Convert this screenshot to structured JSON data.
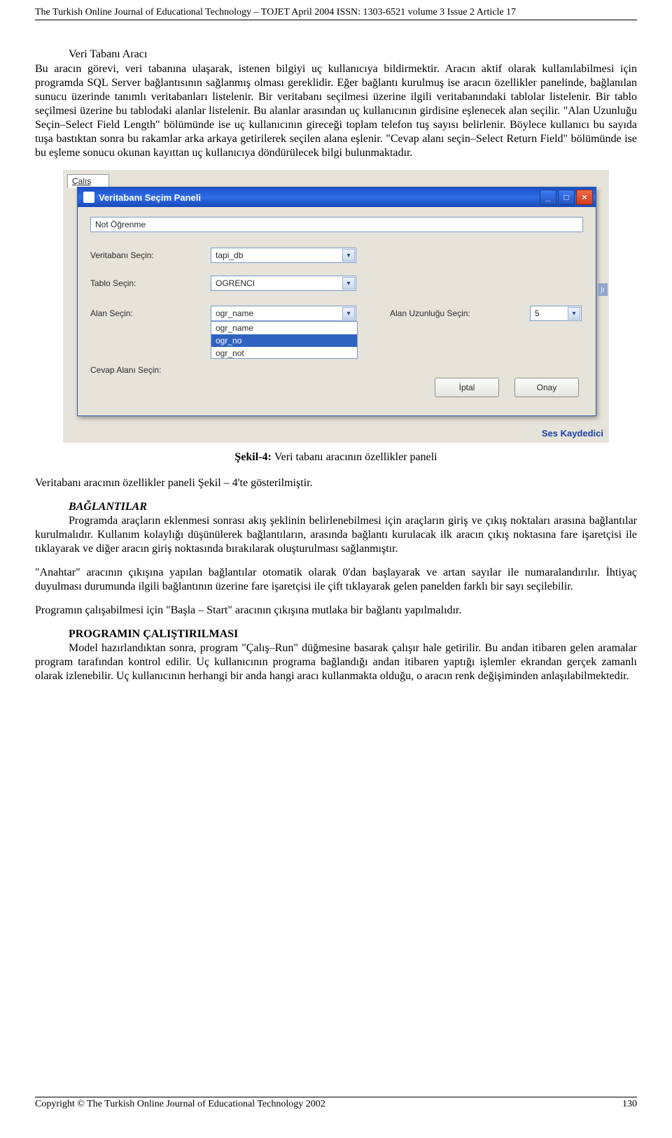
{
  "header_line": "The Turkish Online Journal of Educational Technology – TOJET April 2004 ISSN: 1303-6521 volume 3 Issue 2 Article 17",
  "section1_title": "Veri Tabanı Aracı",
  "section1_body": "Bu aracın görevi, veri tabanına ulaşarak, istenen bilgiyi uç kullanıcıya bildirmektir. Aracın aktif olarak kullanılabilmesi için programda SQL Server bağlantısının sağlanmış olması gereklidir. Eğer bağlantı kurulmuş ise aracın özellikler panelinde, bağlanılan sunucu üzerinde tanımlı veritabanları listelenir. Bir veritabanı seçilmesi üzerine ilgili veritabanındaki tablolar listelenir. Bir tablo seçilmesi üzerine bu tablodaki alanlar listelenir. Bu alanlar arasından uç kullanıcının girdisine eşlenecek alan seçilir. \"Alan Uzunluğu Seçin–Select Field Length\" bölümünde ise uç kullanıcının gireceği toplam telefon tuş sayısı belirlenir. Böylece kullanıcı bu sayıda tuşa bastıktan sonra bu rakamlar arka arkaya getirilerek seçilen alana eşlenir. \"Cevap alanı seçin–Select Return Field\" bölümünde ise bu eşleme sonucu okunan kayıttan uç kullanıcıya döndürülecek bilgi bulunmaktadır.",
  "screenshot": {
    "bg_tab": "Çalış",
    "window_title": "Veritabanı Seçim Paneli",
    "top_input": "Not Öğrenme",
    "labels": {
      "db": "Veritabanı Seçin:",
      "table": "Tablo Seçin:",
      "field": "Alan Seçin:",
      "field_length": "Alan Uzunluğu Seçin:",
      "return_field": "Cevap Alanı Seçin:"
    },
    "values": {
      "db": "tapi_db",
      "table": "OGRENCI",
      "field": "ogr_name",
      "field_length": "5",
      "list": [
        "ogr_name",
        "ogr_no",
        "ogr_not"
      ],
      "list_selected_index": 1
    },
    "buttons": {
      "cancel": "İptal",
      "ok": "Onay"
    },
    "side_label": "jı",
    "bottom_bar": "Ses Kaydedici"
  },
  "caption_prefix": "Şekil-4: ",
  "caption_rest": "Veri tabanı aracının özellikler paneli",
  "after_caption": "Veritabanı aracının özellikler paneli Şekil – 4'te gösterilmiştir.",
  "section2_title": "BAĞLANTILAR",
  "section2_body": "Programda araçların eklenmesi sonrası akış şeklinin belirlenebilmesi için araçların giriş ve çıkış noktaları arasına bağlantılar kurulmalıdır. Kullanım kolaylığı düşünülerek bağlantıların, arasında bağlantı kurulacak ilk aracın çıkış noktasına fare işaretçisi ile tıklayarak ve diğer aracın giriş noktasında bırakılarak oluşturulması sağlanmıştır.",
  "para3": "\"Anahtar\" aracının çıkışına yapılan bağlantılar otomatik olarak 0'dan başlayarak ve artan sayılar ile numaralandırılır. İhtiyaç duyulması durumunda ilgili bağlantının üzerine fare işaretçisi ile çift tıklayarak gelen panelden farklı bir sayı seçilebilir.",
  "para4": "Programın çalışabilmesi için \"Başla – Start\" aracının çıkışına mutlaka bir bağlantı yapılmalıdır.",
  "section3_title": "PROGRAMIN ÇALIŞTIRILMASI",
  "section3_body": "Model hazırlandıktan sonra, program \"Çalış–Run\" düğmesine basarak çalışır hale getirilir.  Bu andan itibaren gelen aramalar program tarafından kontrol edilir. Uç kullanıcının programa bağlandığı andan itibaren yaptığı işlemler ekrandan gerçek zamanlı olarak izlenebilir. Uç kullanıcının herhangi bir anda hangi aracı kullanmakta olduğu, o aracın renk değişiminden anlaşılabilmektedir.",
  "footer_left": "Copyright © The Turkish Online Journal of Educational Technology 2002",
  "footer_right": "130"
}
